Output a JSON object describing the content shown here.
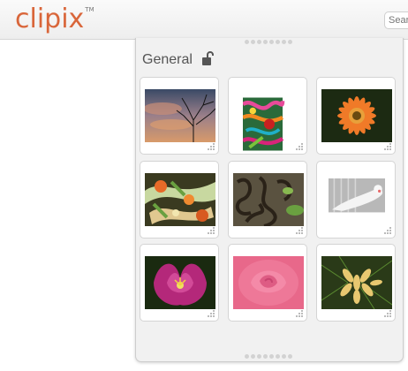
{
  "app": {
    "logo": "clipix",
    "trademark": "TM"
  },
  "search": {
    "placeholder": "Search"
  },
  "panel": {
    "title": "General",
    "lock_icon": "unlock-icon",
    "items": [
      {
        "name": "clip-sunset-tree"
      },
      {
        "name": "clip-ribbons"
      },
      {
        "name": "clip-orange-gerbera"
      },
      {
        "name": "clip-salad"
      },
      {
        "name": "clip-vine-tendrils"
      },
      {
        "name": "clip-white-bird"
      },
      {
        "name": "clip-pink-tulip"
      },
      {
        "name": "clip-pink-rose"
      },
      {
        "name": "clip-pine-buds"
      }
    ]
  },
  "colors": {
    "logo": "#d9663a",
    "panel_bg": "#f1f1f1"
  }
}
